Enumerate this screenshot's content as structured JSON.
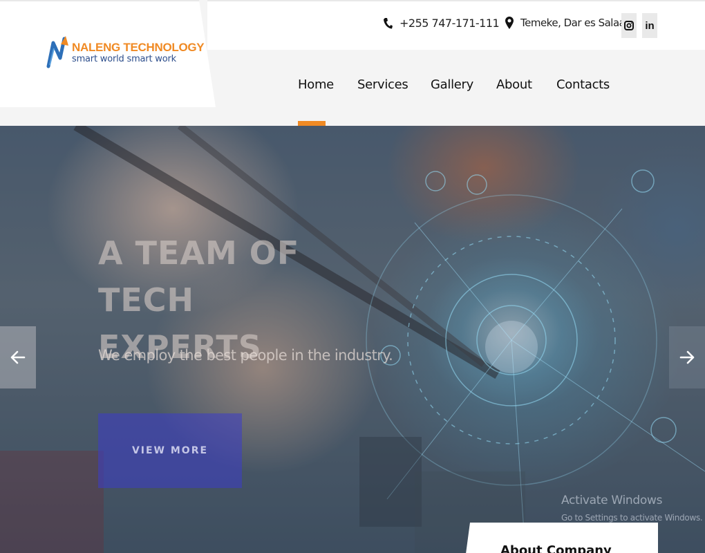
{
  "brand": {
    "name": "NALENG TECHNOLOGY",
    "tagline": "smart world smart work",
    "colors": {
      "accent": "#f08a24",
      "primary": "#2d4e8c"
    }
  },
  "topbar": {
    "phone": "+255 747-171-111",
    "location": "Temeke, Dar es Salaam",
    "social": [
      {
        "icon": "instagram-icon"
      },
      {
        "icon": "linkedin-icon",
        "label": "in"
      }
    ]
  },
  "nav": {
    "items": [
      {
        "label": "Home",
        "active": true
      },
      {
        "label": "Services"
      },
      {
        "label": "Gallery"
      },
      {
        "label": "About"
      },
      {
        "label": "Contacts"
      }
    ]
  },
  "hero": {
    "title_line1": "A TEAM OF TECH",
    "title_line2": "EXPERTS",
    "subtitle": "We employ the best people in the industry.",
    "button_label": "VIEW MORE",
    "prev_icon": "arrow-left-icon",
    "next_icon": "arrow-right-icon"
  },
  "overlay": {
    "watermark_title": "Activate Windows",
    "watermark_sub": "Go to Settings to activate Windows."
  },
  "about_card": {
    "title": "About Company"
  }
}
